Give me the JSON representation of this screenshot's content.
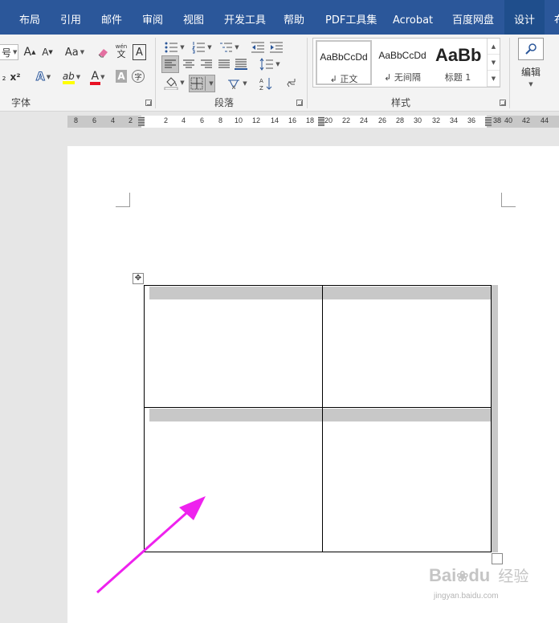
{
  "tabs": [
    {
      "label": "布局"
    },
    {
      "label": "引用"
    },
    {
      "label": "邮件"
    },
    {
      "label": "审阅"
    },
    {
      "label": "视图"
    },
    {
      "label": "开发工具"
    },
    {
      "label": "帮助"
    },
    {
      "label": "PDF工具集"
    },
    {
      "label": "Acrobat"
    },
    {
      "label": "百度网盘"
    },
    {
      "label": "设计"
    },
    {
      "label": "布"
    }
  ],
  "font_group": {
    "label": "字体",
    "size_fragment": "号",
    "grow_font": "A",
    "shrink_font": "A",
    "change_case": "Aa",
    "phonetic_guide": "wén",
    "phonetic_char": "文",
    "char_border": "A",
    "subscript": "₂",
    "superscript": "x²",
    "text_effects": "A",
    "highlight": "ab",
    "font_color": "A",
    "char_shading": "A",
    "enclose_char": "字"
  },
  "paragraph_group": {
    "label": "段落"
  },
  "styles_group": {
    "label": "样式",
    "tiles": [
      {
        "sample": "AaBbCcDd",
        "name": "↲ 正文"
      },
      {
        "sample": "AaBbCcDd",
        "name": "↲ 无间隔"
      },
      {
        "sample": "AaBb",
        "name": "标题 1"
      }
    ]
  },
  "editing_group": {
    "label": "编辑"
  },
  "ruler": {
    "numbers": [
      "8",
      "6",
      "4",
      "2",
      "2",
      "4",
      "6",
      "8",
      "10",
      "12",
      "14",
      "16",
      "18",
      "20",
      "22",
      "24",
      "26",
      "28",
      "30",
      "32",
      "34",
      "36",
      "38",
      "40",
      "42",
      "44"
    ]
  },
  "table": {
    "rows": 2,
    "cols": 2
  },
  "watermark": {
    "brand": "Bai",
    "brand2": "du",
    "label": "经验",
    "url": "jingyan.baidu.com"
  },
  "colors": {
    "ribbon_tab": "#2b579a",
    "arrow": "#ee22ee",
    "highlight_bar": "#ffff00",
    "font_color_bar": "#e81123"
  }
}
